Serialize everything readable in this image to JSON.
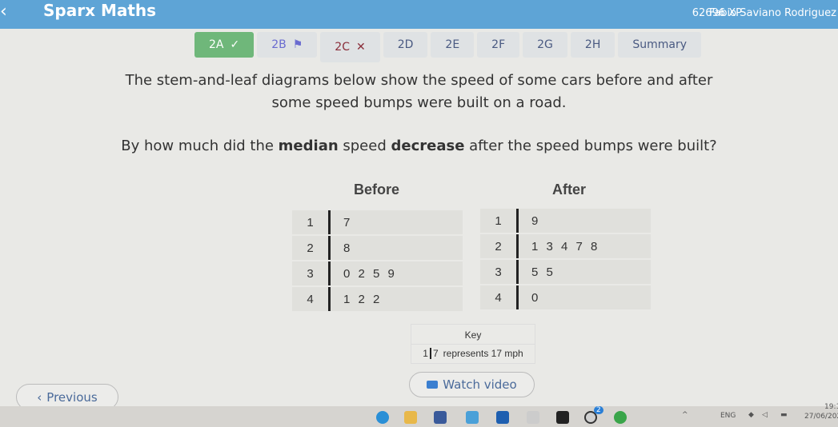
{
  "header": {
    "back_icon": "chevron-left",
    "title": "Sparx Maths",
    "xp": "62696 XP",
    "user": "Fabio Saviano Rodriguez"
  },
  "tabs": [
    {
      "label": "2A",
      "status": "✓"
    },
    {
      "label": "2B",
      "status": "⚑"
    },
    {
      "label": "2C",
      "status": "✕"
    },
    {
      "label": "2D"
    },
    {
      "label": "2E"
    },
    {
      "label": "2F"
    },
    {
      "label": "2G"
    },
    {
      "label": "2H"
    },
    {
      "label": "Summary"
    }
  ],
  "question": {
    "line1": "The stem-and-leaf diagrams below show the speed of some cars before and after",
    "line2": "some speed bumps were built on a road.",
    "line3_pre": "By how much did the ",
    "line3_b1": "median",
    "line3_mid": " speed ",
    "line3_b2": "decrease",
    "line3_post": " after the speed bumps were built?"
  },
  "before": {
    "title": "Before",
    "rows": [
      {
        "stem": "1",
        "leaves": "7"
      },
      {
        "stem": "2",
        "leaves": "8"
      },
      {
        "stem": "3",
        "leaves": "0 2 5 9"
      },
      {
        "stem": "4",
        "leaves": "1 2 2"
      }
    ]
  },
  "after": {
    "title": "After",
    "rows": [
      {
        "stem": "1",
        "leaves": "9"
      },
      {
        "stem": "2",
        "leaves": "1 3 4 7 8"
      },
      {
        "stem": "3",
        "leaves": "5 5"
      },
      {
        "stem": "4",
        "leaves": "0"
      }
    ]
  },
  "key": {
    "title": "Key",
    "stem": "1",
    "leaf": "7",
    "text": "represents 17 mph"
  },
  "buttons": {
    "previous": "Previous",
    "watch": "Watch video"
  },
  "taskbar": {
    "lang": "ENG",
    "time": "19:1",
    "date": "27/06/202",
    "whatsapp_badge": "2"
  }
}
